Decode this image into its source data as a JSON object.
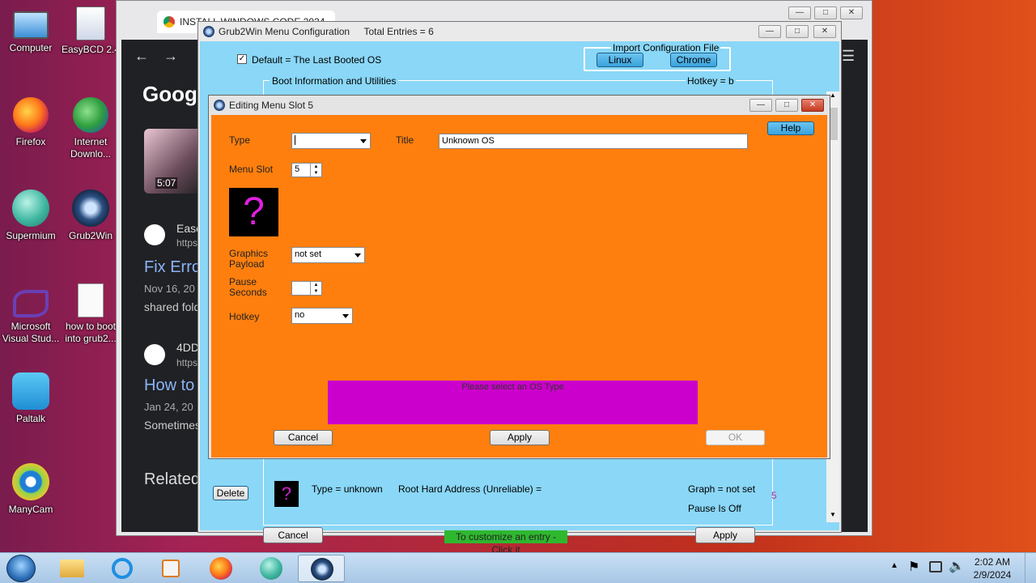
{
  "desktop": {
    "icons": [
      {
        "label": "Computer"
      },
      {
        "label": "EasyBCD 2.4"
      },
      {
        "label": "Firefox"
      },
      {
        "label": "Internet Downlo..."
      },
      {
        "label": "Supermium"
      },
      {
        "label": "Grub2Win"
      },
      {
        "label": "Microsoft Visual Stud..."
      },
      {
        "label": "how to boot into grub2..."
      },
      {
        "label": "Paltalk"
      },
      {
        "label": "ManyCam"
      }
    ]
  },
  "browser": {
    "tab_title": "INSTALL WINDOWS CODE 2024",
    "google_logo": "Goog",
    "video_duration": "5:07",
    "results": [
      {
        "site": "Ease",
        "url": "https",
        "title": "Fix Erro",
        "date": "Nov 16, 20",
        "snippet": "shared fold"
      },
      {
        "site": "4DD",
        "url": "https",
        "title": "How to",
        "date": "Jan 24, 20",
        "snippet": "Sometimes"
      }
    ],
    "related": "Related"
  },
  "grub2win": {
    "title": "Grub2Win Menu Configuration",
    "total_entries": "Total Entries = 6",
    "default_label": "Default = The Last Booted OS",
    "import_label": "Import Configuration File",
    "linux_btn": "Linux",
    "chrome_btn": "Chrome",
    "boot_info": "Boot Information and Utilities",
    "hotkey_b": "Hotkey = b",
    "delete_btn": "Delete",
    "entry_type": "Type = unknown",
    "root_hd": "Root Hard Address (Unreliable) =",
    "graph": "Graph = not set",
    "pause": "Pause Is Off",
    "slot_num": "5",
    "cancel_btn": "Cancel",
    "apply_btn": "Apply",
    "customize_note": "To customize an entry - Click it"
  },
  "editor": {
    "title": "Editing Menu Slot 5",
    "help_btn": "Help",
    "type_label": "Type",
    "type_value": "",
    "title_label": "Title",
    "title_value": "Unknown OS",
    "menu_slot_label": "Menu Slot",
    "menu_slot_value": "5",
    "graphics_label_1": "Graphics",
    "graphics_label_2": "Payload",
    "graphics_value": "not set",
    "pause_label_1": "Pause",
    "pause_label_2": "Seconds",
    "pause_value": "",
    "hotkey_label": "Hotkey",
    "hotkey_value": "no",
    "message": "Please select an OS Type",
    "cancel_btn": "Cancel",
    "apply_btn": "Apply",
    "ok_btn": "OK",
    "colors": {
      "background": "#ff7f0e",
      "message_bg": "#cc00cc"
    }
  },
  "taskbar": {
    "time": "2:02 AM",
    "date": "2/9/2024"
  }
}
